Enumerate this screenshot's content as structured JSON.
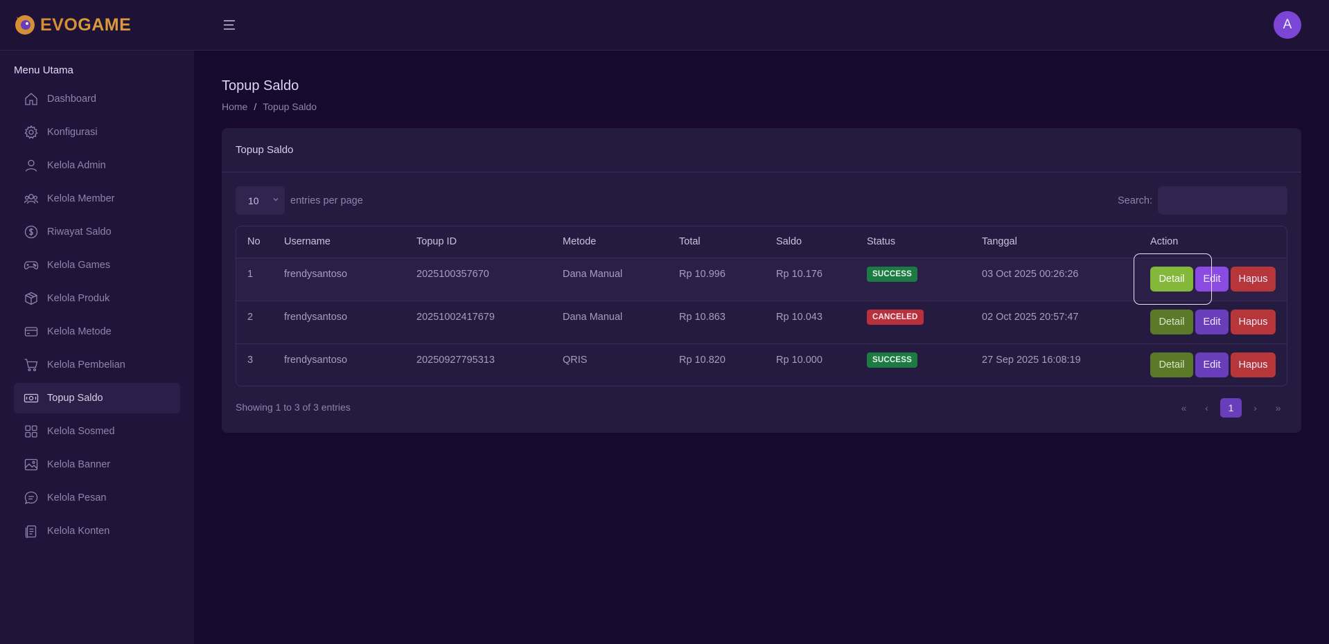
{
  "app": {
    "logo_left": "EVO",
    "logo_right": "GAME",
    "avatar_initial": "A"
  },
  "sidebar": {
    "heading": "Menu Utama",
    "items": [
      {
        "label": "Dashboard",
        "icon": "home-icon"
      },
      {
        "label": "Konfigurasi",
        "icon": "gear-icon"
      },
      {
        "label": "Kelola Admin",
        "icon": "user-icon"
      },
      {
        "label": "Kelola Member",
        "icon": "users-icon"
      },
      {
        "label": "Riwayat Saldo",
        "icon": "dollar-circle-icon"
      },
      {
        "label": "Kelola Games",
        "icon": "gamepad-icon"
      },
      {
        "label": "Kelola Produk",
        "icon": "box-icon"
      },
      {
        "label": "Kelola Metode",
        "icon": "card-icon"
      },
      {
        "label": "Kelola Pembelian",
        "icon": "cart-icon"
      },
      {
        "label": "Topup Saldo",
        "icon": "cash-icon",
        "active": true
      },
      {
        "label": "Kelola Sosmed",
        "icon": "grid-icon"
      },
      {
        "label": "Kelola Banner",
        "icon": "image-icon"
      },
      {
        "label": "Kelola Pesan",
        "icon": "chat-icon"
      },
      {
        "label": "Kelola Konten",
        "icon": "document-icon"
      }
    ]
  },
  "page": {
    "title": "Topup Saldo",
    "breadcrumb": {
      "home": "Home",
      "separator": "/",
      "current": "Topup Saldo"
    }
  },
  "card": {
    "title": "Topup Saldo",
    "entries": {
      "value": "10",
      "label": "entries per page"
    },
    "search": {
      "label": "Search:",
      "value": "",
      "placeholder": ""
    },
    "table": {
      "headers": [
        "No",
        "Username",
        "Topup ID",
        "Metode",
        "Total",
        "Saldo",
        "Status",
        "Tanggal",
        "Action"
      ],
      "rows": [
        {
          "no": "1",
          "username": "frendysantoso",
          "topup_id": "2025100357670",
          "metode": "Dana Manual",
          "total": "Rp 10.996",
          "saldo": "Rp 10.176",
          "status": "SUCCESS",
          "tanggal": "03 Oct 2025 00:26:26"
        },
        {
          "no": "2",
          "username": "frendysantoso",
          "topup_id": "20251002417679",
          "metode": "Dana Manual",
          "total": "Rp 10.863",
          "saldo": "Rp 10.043",
          "status": "CANCELED",
          "tanggal": "02 Oct 2025 20:57:47"
        },
        {
          "no": "3",
          "username": "frendysantoso",
          "topup_id": "20250927795313",
          "metode": "QRIS",
          "total": "Rp 10.820",
          "saldo": "Rp 10.000",
          "status": "SUCCESS",
          "tanggal": "27 Sep 2025 16:08:19"
        }
      ],
      "actions": {
        "detail": "Detail",
        "edit": "Edit",
        "hapus": "Hapus"
      }
    },
    "footer": {
      "info": "Showing 1 to 3 of 3 entries"
    },
    "pagination": {
      "first": "«",
      "prev": "‹",
      "current": "1",
      "next": "›",
      "last": "»"
    }
  },
  "colors": {
    "background": "#170a2e",
    "sidebar": "#21143a",
    "card": "#251a3f",
    "accent": "#6a3dbb",
    "success": "#1c7a43",
    "danger": "#b7363a",
    "detail": "#5a7a2a",
    "logo": "#d58f34"
  }
}
